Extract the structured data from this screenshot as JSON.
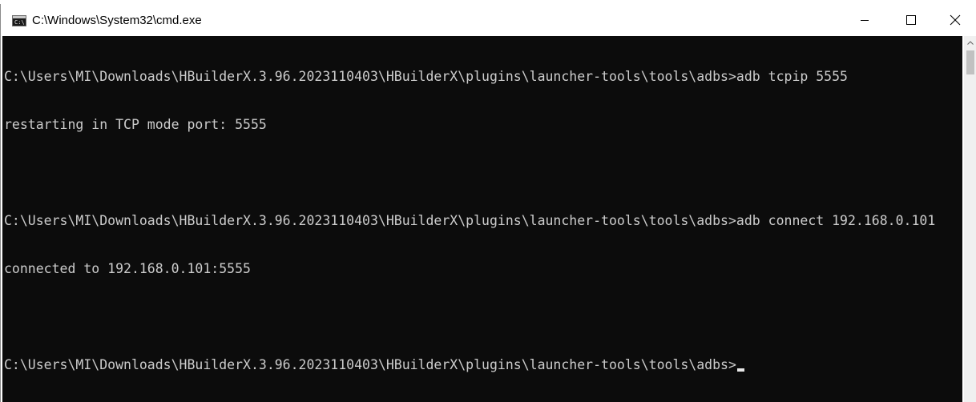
{
  "window": {
    "title": "C:\\Windows\\System32\\cmd.exe",
    "icon": "cmd-console-icon",
    "icon_glyph": "C:\\"
  },
  "controls": {
    "minimize_icon": "minimize-icon",
    "maximize_icon": "maximize-icon",
    "close_icon": "close-icon"
  },
  "console": {
    "lines": [
      "C:\\Users\\MI\\Downloads\\HBuilderX.3.96.2023110403\\HBuilderX\\plugins\\launcher-tools\\tools\\adbs>adb tcpip 5555",
      "restarting in TCP mode port: 5555",
      "",
      "C:\\Users\\MI\\Downloads\\HBuilderX.3.96.2023110403\\HBuilderX\\plugins\\launcher-tools\\tools\\adbs>adb connect 192.168.0.101",
      "connected to 192.168.0.101:5555",
      "",
      "C:\\Users\\MI\\Downloads\\HBuilderX.3.96.2023110403\\HBuilderX\\plugins\\launcher-tools\\tools\\adbs>"
    ],
    "background_color": "#0c0c0c",
    "text_color": "#cccccc"
  }
}
